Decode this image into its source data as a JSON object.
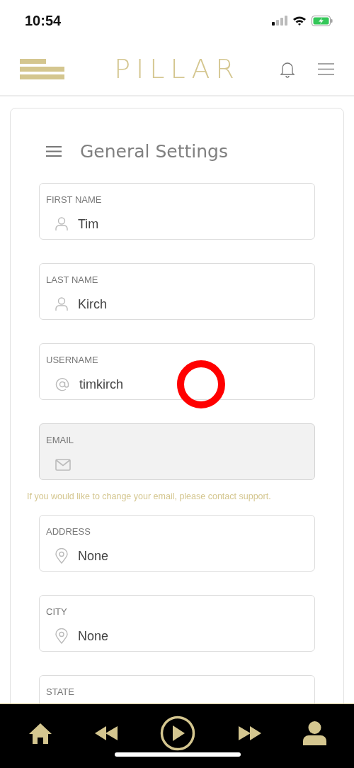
{
  "status_bar": {
    "time": "10:54"
  },
  "header": {
    "logo": "PILLAR"
  },
  "settings": {
    "title": "General Settings",
    "fields": [
      {
        "label": "FIRST NAME",
        "kind": "person",
        "value": "Tim",
        "disabled": false
      },
      {
        "label": "LAST NAME",
        "kind": "person",
        "value": "Kirch",
        "disabled": false
      },
      {
        "label": "USERNAME",
        "kind": "at",
        "value": "timkirch",
        "disabled": false
      },
      {
        "label": "EMAIL",
        "kind": "mail",
        "disabled": true
      },
      {
        "kind": "note",
        "text": "If you would like to change your email, please contact support."
      },
      {
        "label": "ADDRESS",
        "kind": "pin",
        "value": "None",
        "disabled": false
      },
      {
        "label": "CITY",
        "kind": "pin",
        "value": "None",
        "disabled": false
      },
      {
        "label": "STATE",
        "disabled": false
      }
    ]
  },
  "touch_indicator": {
    "visible": true
  },
  "nav": [
    {
      "kind": "home"
    },
    {
      "kind": "rewind"
    },
    {
      "kind": "play"
    },
    {
      "kind": "forward"
    },
    {
      "kind": "profile"
    }
  ]
}
